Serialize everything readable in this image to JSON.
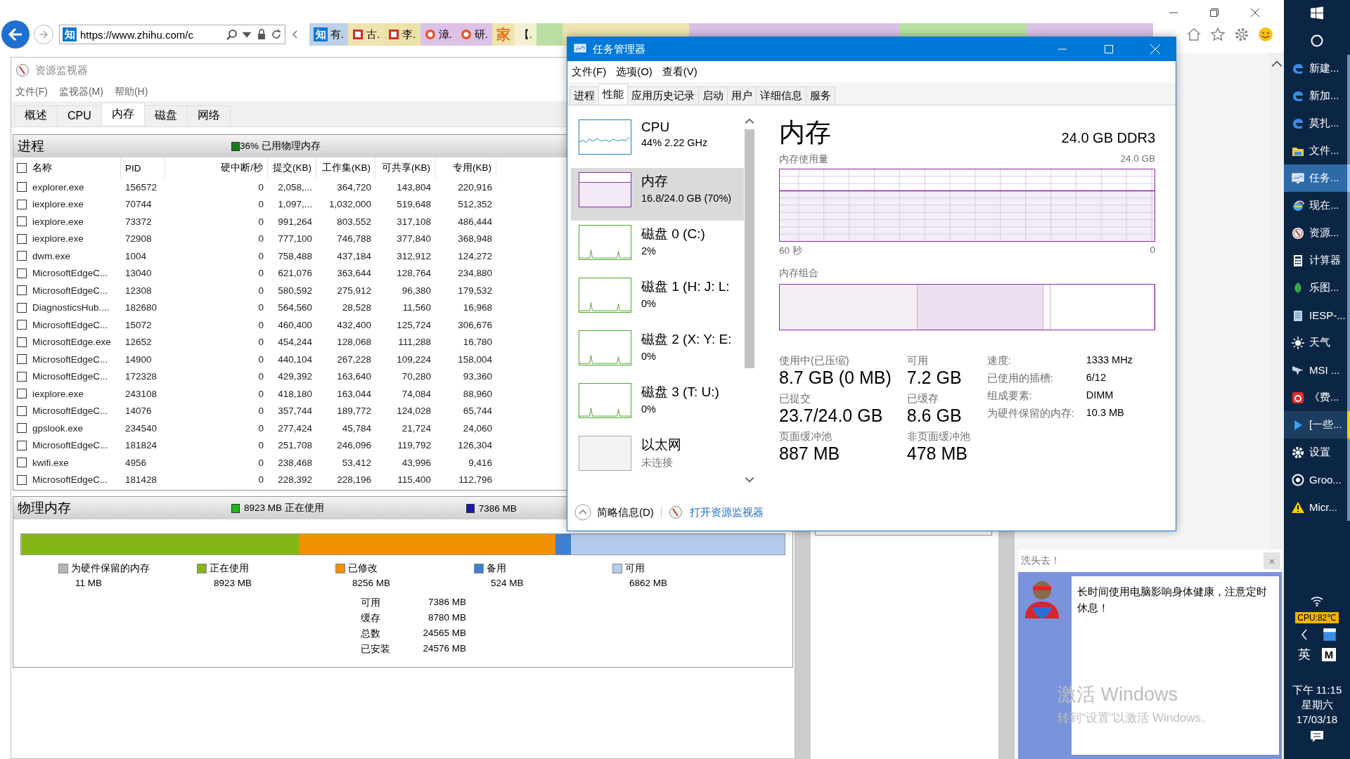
{
  "browser": {
    "site_icon": "知",
    "address": "https://www.zhihu.com/c",
    "favorites": [
      {
        "kind": "text-icon",
        "icon_text": "知",
        "label": "有.",
        "color": "#bcd0e8"
      },
      {
        "kind": "red-icon",
        "label": "古.",
        "color": "#efe4b0"
      },
      {
        "kind": "red-icon",
        "label": "李.",
        "color": "#ece2a8"
      },
      {
        "kind": "orange-icon",
        "label": "漳.",
        "color": "#dcc2e6"
      },
      {
        "kind": "orange-icon",
        "label": "研.",
        "color": "#dcc2e6"
      },
      {
        "kind": "glyph",
        "label": "家",
        "color": "#efe4b0"
      },
      {
        "kind": "plain",
        "label": "【.",
        "color": "#f4efd2"
      }
    ]
  },
  "resource_monitor": {
    "title": "资源监视器",
    "menu": [
      "文件(F)",
      "监视器(M)",
      "帮助(H)"
    ],
    "tabs": [
      {
        "label": "概述",
        "selected": false
      },
      {
        "label": "CPU",
        "selected": false
      },
      {
        "label": "内存",
        "selected": true
      },
      {
        "label": "磁盘",
        "selected": false
      },
      {
        "label": "网络",
        "selected": false
      }
    ],
    "processes": {
      "title": "进程",
      "summary": "36% 已用物理内存",
      "select_all_checked": false,
      "columns": [
        "名称",
        "PID",
        "硬中断/秒",
        "提交(KB)",
        "工作集(KB)",
        "可共享(KB)",
        "专用(KB)"
      ],
      "rows": [
        {
          "checked": false,
          "cells": [
            "explorer.exe",
            "156572",
            "0",
            "2,058,...",
            "364,720",
            "143,804",
            "220,916"
          ]
        },
        {
          "checked": false,
          "cells": [
            "iexplore.exe",
            "70744",
            "0",
            "1,097,...",
            "1,032,000",
            "519,648",
            "512,352"
          ]
        },
        {
          "checked": false,
          "cells": [
            "iexplore.exe",
            "73372",
            "0",
            "991,264",
            "803,552",
            "317,108",
            "486,444"
          ]
        },
        {
          "checked": false,
          "cells": [
            "iexplore.exe",
            "72908",
            "0",
            "777,100",
            "746,788",
            "377,840",
            "368,948"
          ]
        },
        {
          "checked": false,
          "cells": [
            "dwm.exe",
            "1004",
            "0",
            "758,488",
            "437,184",
            "312,912",
            "124,272"
          ]
        },
        {
          "checked": false,
          "cells": [
            "MicrosoftEdgeC...",
            "13040",
            "0",
            "621,076",
            "363,644",
            "128,764",
            "234,880"
          ]
        },
        {
          "checked": false,
          "cells": [
            "MicrosoftEdgeC...",
            "12308",
            "0",
            "580,592",
            "275,912",
            "96,380",
            "179,532"
          ]
        },
        {
          "checked": false,
          "cells": [
            "DiagnosticsHub....",
            "182680",
            "0",
            "564,560",
            "28,528",
            "11,560",
            "16,968"
          ]
        },
        {
          "checked": false,
          "cells": [
            "MicrosoftEdgeC...",
            "15072",
            "0",
            "460,400",
            "432,400",
            "125,724",
            "306,676"
          ]
        },
        {
          "checked": false,
          "cells": [
            "MicrosoftEdge.exe",
            "12652",
            "0",
            "454,244",
            "128,068",
            "111,288",
            "16,780"
          ]
        },
        {
          "checked": false,
          "cells": [
            "MicrosoftEdgeC...",
            "14900",
            "0",
            "440,104",
            "267,228",
            "109,224",
            "158,004"
          ]
        },
        {
          "checked": false,
          "cells": [
            "MicrosoftEdgeC...",
            "172328",
            "0",
            "429,392",
            "163,640",
            "70,280",
            "93,360"
          ]
        },
        {
          "checked": false,
          "cells": [
            "iexplore.exe",
            "243108",
            "0",
            "418,180",
            "163,044",
            "74,084",
            "88,960"
          ]
        },
        {
          "checked": false,
          "cells": [
            "MicrosoftEdgeC...",
            "14076",
            "0",
            "357,744",
            "189,772",
            "124,028",
            "65,744"
          ]
        },
        {
          "checked": false,
          "cells": [
            "gpslook.exe",
            "234540",
            "0",
            "277,424",
            "45,784",
            "21,724",
            "24,060"
          ]
        },
        {
          "checked": false,
          "cells": [
            "MicrosoftEdgeC...",
            "181824",
            "0",
            "251,708",
            "246,096",
            "119,792",
            "126,304"
          ]
        },
        {
          "checked": false,
          "cells": [
            "kwifi.exe",
            "4956",
            "0",
            "238,468",
            "53,412",
            "43,996",
            "9,416"
          ]
        },
        {
          "checked": false,
          "cells": [
            "MicrosoftEdgeC...",
            "181428",
            "0",
            "228,392",
            "228,196",
            "115,400",
            "112,796"
          ]
        }
      ]
    },
    "physical_memory": {
      "title": "物理内存",
      "in_use_summary": "8923 MB 正在使用",
      "available_summary": "7386 MB",
      "legend": [
        {
          "label": "为硬件保留的内存",
          "value": "11 MB",
          "color": "#b5b5b5"
        },
        {
          "label": "正在使用",
          "value": "8923 MB",
          "color": "#84b516"
        },
        {
          "label": "已修改",
          "value": "8256 MB",
          "color": "#f29100"
        },
        {
          "label": "备用",
          "value": "524 MB",
          "color": "#3f7fd1"
        },
        {
          "label": "可用",
          "value": "6862 MB",
          "color": "#b3cbec"
        }
      ],
      "stats": [
        {
          "label": "可用",
          "value": "7386 MB"
        },
        {
          "label": "缓存",
          "value": "8780 MB"
        },
        {
          "label": "总数",
          "value": "24565 MB"
        },
        {
          "label": "已安装",
          "value": "24576 MB"
        }
      ]
    }
  },
  "task_manager": {
    "title": "任务管理器",
    "menu": [
      "文件(F)",
      "选项(O)",
      "查看(V)"
    ],
    "tabs": [
      {
        "label": "进程",
        "selected": false
      },
      {
        "label": "性能",
        "selected": true
      },
      {
        "label": "应用历史记录",
        "selected": false
      },
      {
        "label": "启动",
        "selected": false
      },
      {
        "label": "用户",
        "selected": false
      },
      {
        "label": "详细信息",
        "selected": false
      },
      {
        "label": "服务",
        "selected": false
      }
    ],
    "devices": [
      {
        "kind": "cpu",
        "name": "CPU",
        "detail": "44% 2.22 GHz",
        "selected": false
      },
      {
        "kind": "memory",
        "name": "内存",
        "detail": "16.8/24.0 GB (70%)",
        "selected": true
      },
      {
        "kind": "disk",
        "name": "磁盘 0 (C:)",
        "detail": "2%",
        "selected": false
      },
      {
        "kind": "disk",
        "name": "磁盘 1 (H: J: L:",
        "detail": "0%",
        "selected": false
      },
      {
        "kind": "disk",
        "name": "磁盘 2 (X: Y: E:",
        "detail": "0%",
        "selected": false
      },
      {
        "kind": "disk",
        "name": "磁盘 3 (T: U:)",
        "detail": "0%",
        "selected": false
      },
      {
        "kind": "network",
        "name": "以太网",
        "detail": "未连接",
        "selected": false
      }
    ],
    "detail": {
      "title": "内存",
      "spec": "24.0 GB DDR3",
      "usage_label": "内存使用量",
      "usage_max": "24.0 GB",
      "time_start": "60 秒",
      "time_end": "0",
      "composition_label": "内存组合",
      "stats": [
        {
          "label": "使用中(已压缩)",
          "value": "8.7 GB (0 MB)"
        },
        {
          "label": "可用",
          "value": "7.2 GB"
        },
        {
          "label": "已提交",
          "value": "23.7/24.0 GB"
        },
        {
          "label": "已缓存",
          "value": "8.6 GB"
        },
        {
          "label": "页面缓冲池",
          "value": "887 MB"
        },
        {
          "label": "非页面缓冲池",
          "value": "478 MB"
        }
      ],
      "specs": [
        {
          "label": "速度:",
          "value": "1333 MHz"
        },
        {
          "label": "已使用的插槽:",
          "value": "6/12"
        },
        {
          "label": "组成要素:",
          "value": "DIMM"
        },
        {
          "label": "为硬件保留的内存:",
          "value": "10.3 MB"
        }
      ]
    },
    "fewer_details": "简略信息(D)",
    "open_resource_monitor": "打开资源监视器"
  },
  "notification": {
    "title": "洗头去！",
    "close": "×",
    "message": "长时间使用电脑影响身体健康，注意定时休息！"
  },
  "activation": {
    "title": "激活 Windows",
    "hint": "转到“设置”以激活 Windows。"
  },
  "taskbar": {
    "items": [
      {
        "kind": "edge",
        "label": "新建...",
        "selected": false,
        "flashing": false
      },
      {
        "kind": "edge",
        "label": "新加...",
        "selected": false,
        "flashing": false
      },
      {
        "kind": "edge",
        "label": "莫扎...",
        "selected": false,
        "flashing": false
      },
      {
        "kind": "folder",
        "label": "文件...",
        "selected": false,
        "flashing": false
      },
      {
        "kind": "monitor",
        "label": "任务...",
        "selected": true,
        "flashing": false
      },
      {
        "kind": "ie",
        "label": "现在...",
        "selected": false,
        "flashing": false
      },
      {
        "kind": "compass",
        "label": "资源...",
        "selected": false,
        "flashing": false
      },
      {
        "kind": "calculator",
        "label": "计算器",
        "selected": false,
        "flashing": false
      },
      {
        "kind": "leaf",
        "label": "乐图...",
        "selected": false,
        "flashing": false
      },
      {
        "kind": "notepad",
        "label": "IESP-...",
        "selected": false,
        "flashing": false
      },
      {
        "kind": "sun",
        "label": "天气",
        "selected": false,
        "flashing": false
      },
      {
        "kind": "plane",
        "label": "MSI ...",
        "selected": false,
        "flashing": false
      },
      {
        "kind": "music",
        "label": "《费...",
        "selected": false,
        "flashing": false
      },
      {
        "kind": "play",
        "label": "[一些...",
        "selected": false,
        "flashing": true
      },
      {
        "kind": "gear",
        "label": "设置",
        "selected": false,
        "flashing": false
      },
      {
        "kind": "groove",
        "label": "Groo...",
        "selected": false,
        "flashing": false
      },
      {
        "kind": "warning",
        "label": "Micr...",
        "selected": false,
        "flashing": false
      }
    ],
    "cpu_temp": "CPU:82℃",
    "ime": "英",
    "ime_mode": "M",
    "time": "下午 11:15",
    "weekday": "星期六",
    "date": "17/03/18"
  }
}
